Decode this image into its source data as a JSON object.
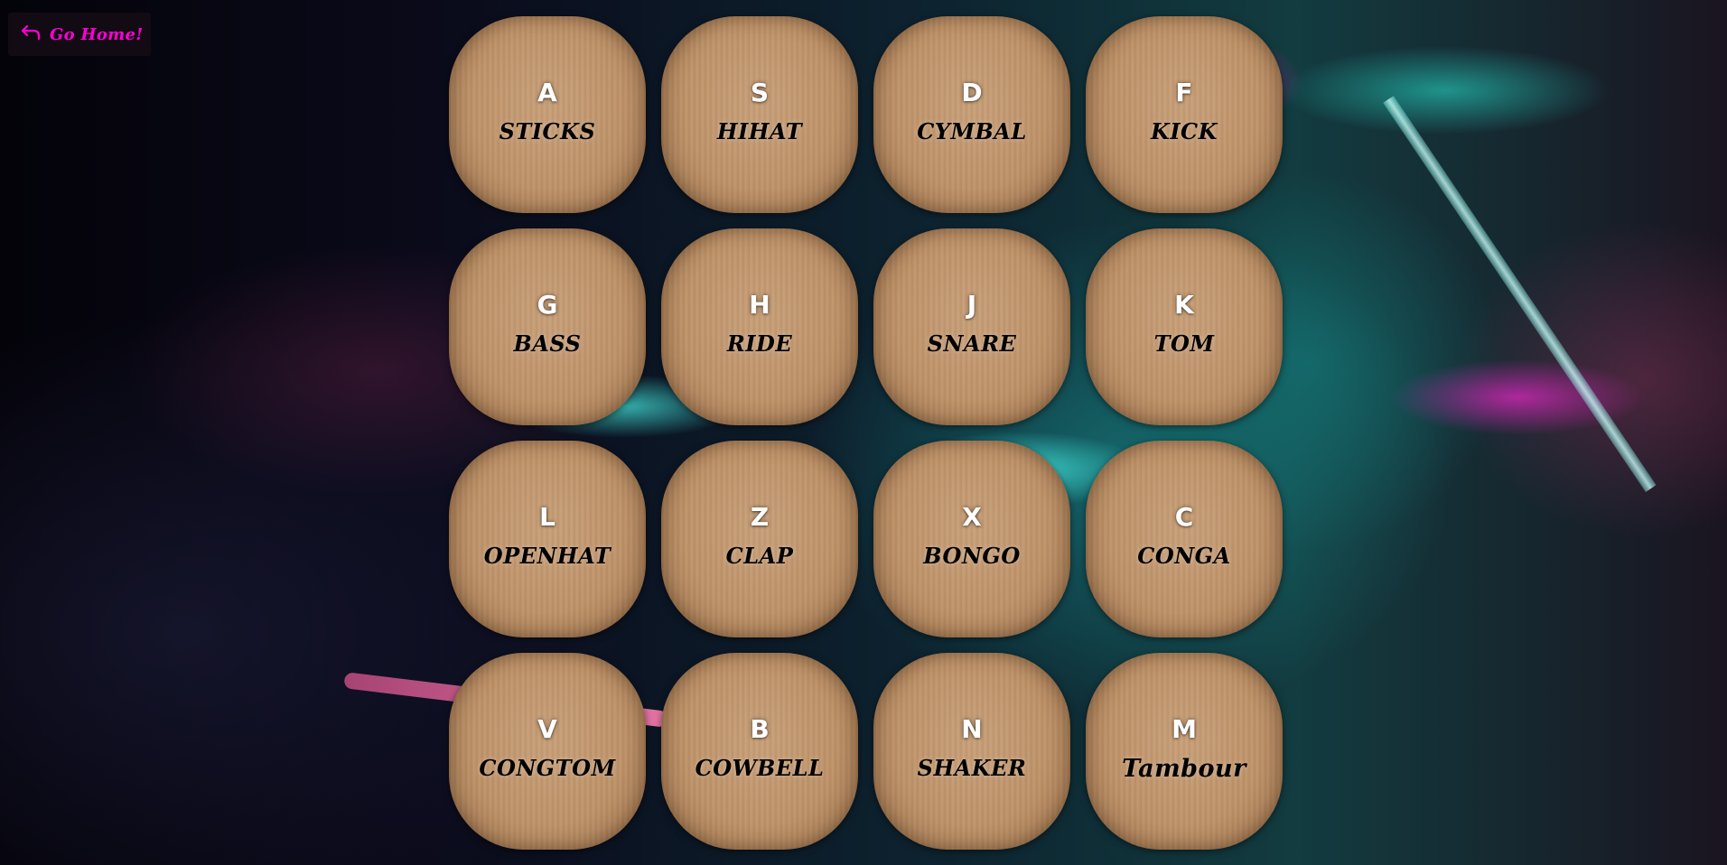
{
  "nav": {
    "home_label": "Go Home!",
    "home_icon": "arrow-return-left-icon",
    "accent_color": "#ff00d4"
  },
  "pads": [
    {
      "key": "A",
      "sound": "STICKS"
    },
    {
      "key": "S",
      "sound": "HIHAT"
    },
    {
      "key": "D",
      "sound": "CYMBAL"
    },
    {
      "key": "F",
      "sound": "KICK"
    },
    {
      "key": "G",
      "sound": "BASS"
    },
    {
      "key": "H",
      "sound": "RIDE"
    },
    {
      "key": "J",
      "sound": "SNARE"
    },
    {
      "key": "K",
      "sound": "TOM"
    },
    {
      "key": "L",
      "sound": "OPENHAT"
    },
    {
      "key": "Z",
      "sound": "CLAP"
    },
    {
      "key": "X",
      "sound": "BONGO"
    },
    {
      "key": "C",
      "sound": "CONGA"
    },
    {
      "key": "V",
      "sound": "CONGTOM"
    },
    {
      "key": "B",
      "sound": "COWBELL"
    },
    {
      "key": "N",
      "sound": "SHAKER"
    },
    {
      "key": "M",
      "sound": "Tambour"
    }
  ]
}
